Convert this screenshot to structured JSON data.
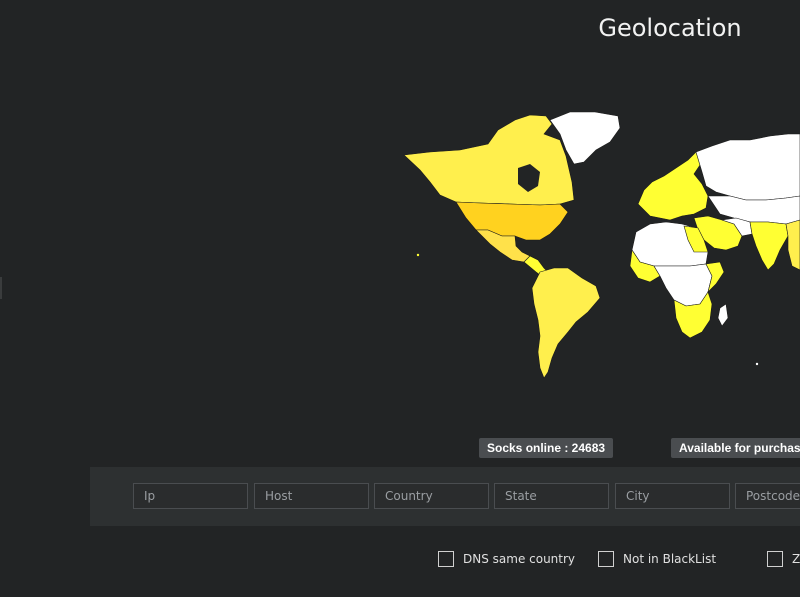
{
  "header": {
    "title": "Geolocation"
  },
  "stats": {
    "socks_online": "Socks online : 24683",
    "available_for_purchase": "Available for purchas"
  },
  "filters": {
    "ip": {
      "placeholder": "Ip",
      "value": ""
    },
    "host": {
      "placeholder": "Host",
      "value": ""
    },
    "country": {
      "placeholder": "Country",
      "value": ""
    },
    "state": {
      "placeholder": "State",
      "value": ""
    },
    "city": {
      "placeholder": "City",
      "value": ""
    },
    "postcode": {
      "placeholder": "Postcode (",
      "value": ""
    }
  },
  "options": [
    {
      "label": "DNS same country",
      "checked": false
    },
    {
      "label": "Not in BlackList",
      "checked": false
    },
    {
      "label": "Zi",
      "checked": false
    }
  ],
  "map": {
    "colors": {
      "ocean": "#222425",
      "no_socks": "#ffffff",
      "low": "#ffff33",
      "medium": "#ffef4d",
      "high": "#ffe14a",
      "highest": "#ffd21f",
      "borders": "#1c1c1c"
    }
  }
}
